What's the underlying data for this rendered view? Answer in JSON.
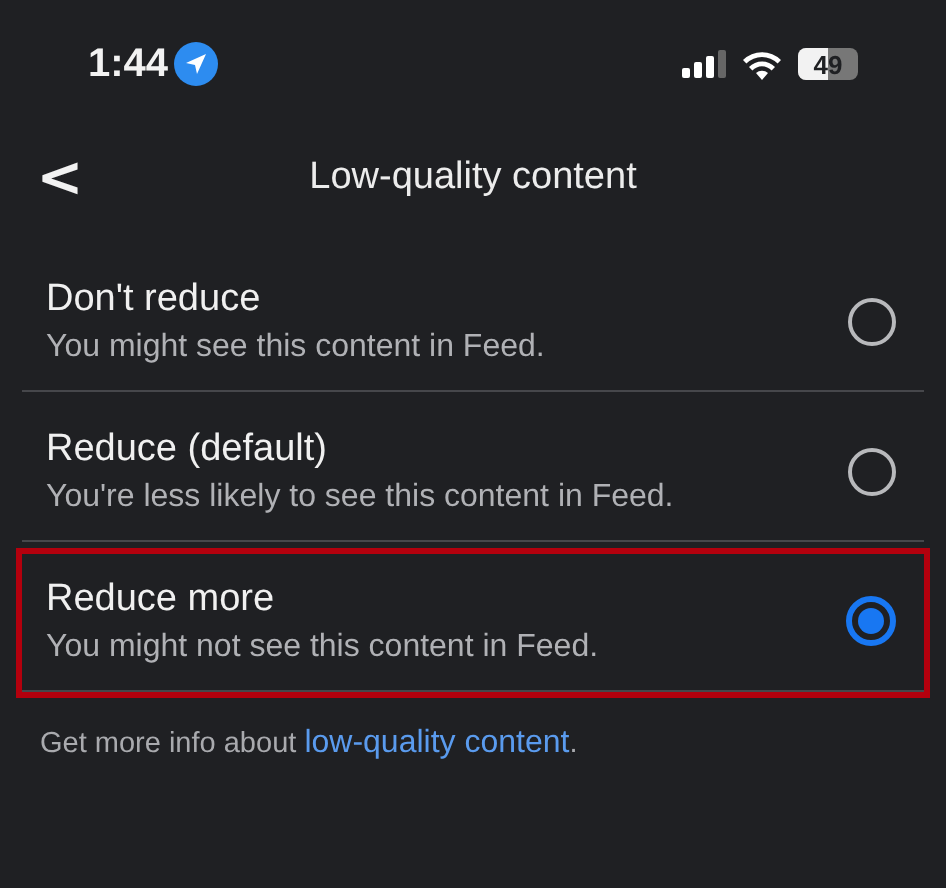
{
  "status_bar": {
    "time": "1:44",
    "battery": "49"
  },
  "header": {
    "back": "<",
    "title": "Low-quality content"
  },
  "options": [
    {
      "label": "Don't reduce",
      "description": "You might see this content in Feed.",
      "selected": false,
      "highlighted": false
    },
    {
      "label": "Reduce (default)",
      "description": "You're less likely to see this content in Feed.",
      "selected": false,
      "highlighted": false
    },
    {
      "label": "Reduce more",
      "description": "You might not see this content in Feed.",
      "selected": true,
      "highlighted": true
    }
  ],
  "footer": {
    "text": "Get more info about ",
    "link": "low-quality content",
    "after": "."
  }
}
